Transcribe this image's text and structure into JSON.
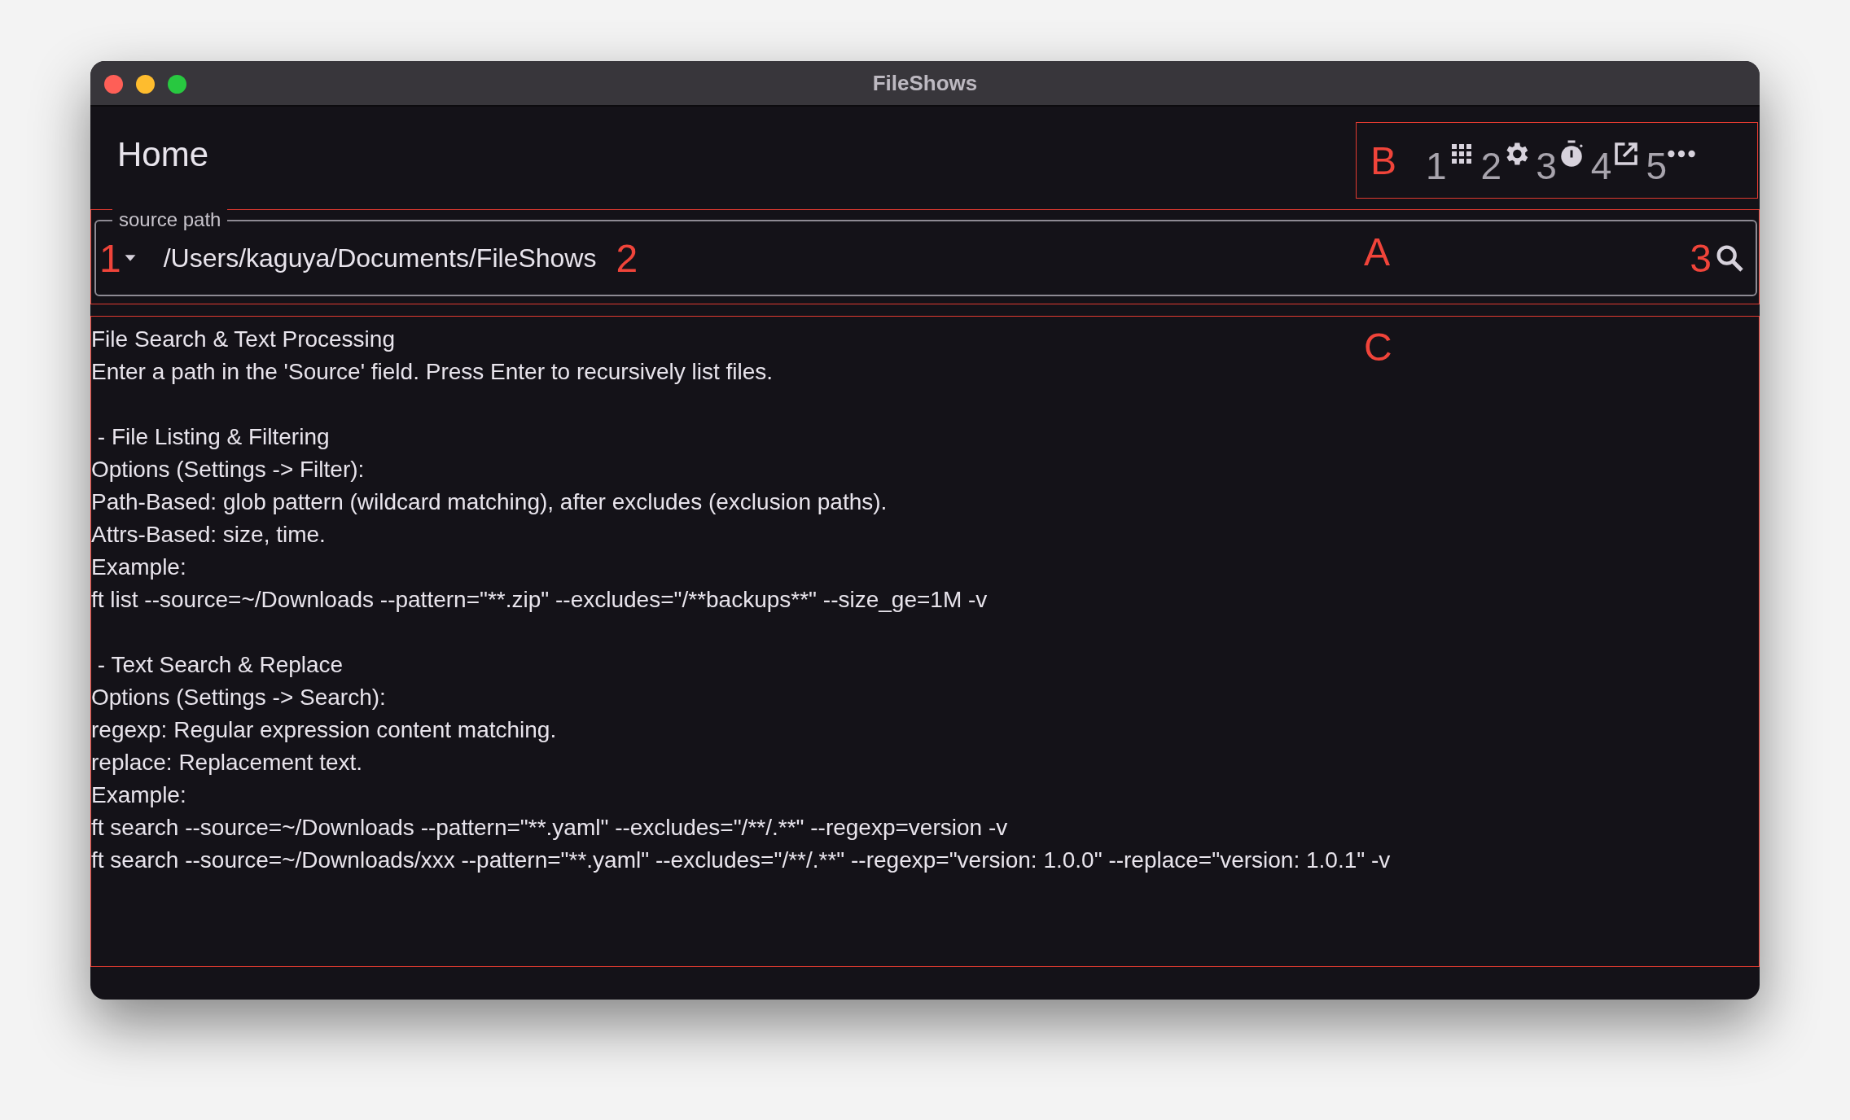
{
  "window": {
    "title": "FileShows"
  },
  "header": {
    "title": "Home",
    "annotation": "B",
    "toolbar": [
      {
        "number": "1",
        "kind": "apps"
      },
      {
        "number": "2",
        "kind": "settings"
      },
      {
        "number": "3",
        "kind": "timer"
      },
      {
        "number": "4",
        "kind": "open"
      },
      {
        "number": "5",
        "kind": "more"
      }
    ]
  },
  "source_field": {
    "label": "source path",
    "value": "/Users/kaguya/Documents/FileShows",
    "annotation": "A",
    "markers": [
      "1",
      "2",
      "3"
    ]
  },
  "help": {
    "annotation": "C",
    "paragraphs": [
      [
        "File Search & Text Processing",
        "Enter a path in the 'Source' field. Press Enter to recursively list files."
      ],
      [
        " - File Listing & Filtering",
        "Options (Settings -> Filter):",
        "Path-Based: glob pattern (wildcard matching), after excludes (exclusion paths).",
        "Attrs-Based: size, time.",
        "Example:",
        "ft list --source=~/Downloads --pattern=\"**.zip\" --excludes=\"/**backups**\" --size_ge=1M -v"
      ],
      [
        " - Text Search & Replace",
        "Options (Settings -> Search):",
        "regexp: Regular expression content matching.",
        "replace: Replacement text.",
        "Example:",
        "ft search --source=~/Downloads --pattern=\"**.yaml\" --excludes=\"/**/.**\" --regexp=version -v",
        "ft search --source=~/Downloads/xxx --pattern=\"**.yaml\" --excludes=\"/**/.**\" --regexp=\"version: 1.0.0\" --replace=\"version: 1.0.1\" -v"
      ]
    ]
  }
}
